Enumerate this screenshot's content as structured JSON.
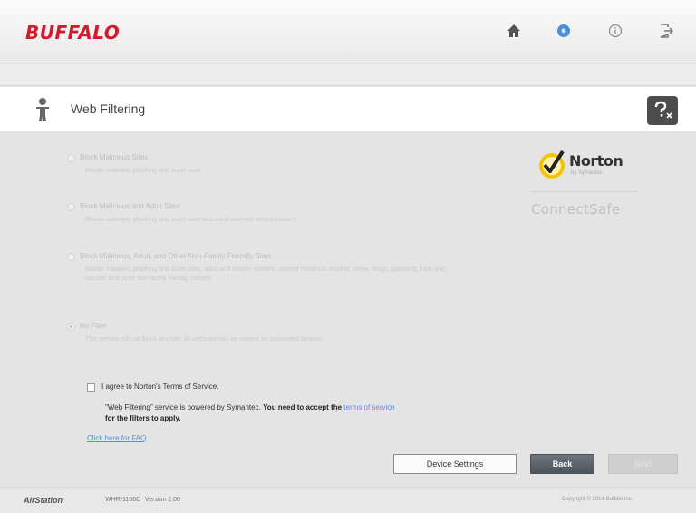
{
  "header": {
    "logo": "BUFFALO",
    "nav": [
      {
        "icon": "home-icon"
      },
      {
        "icon": "settings-gear-icon",
        "active_color": "#4a90d9"
      },
      {
        "icon": "info-icon"
      },
      {
        "icon": "logout-icon"
      }
    ]
  },
  "page": {
    "title": "Web Filtering",
    "title_icon": "person-icon",
    "help_icon": "help-icon"
  },
  "options": [
    {
      "label": "Block Malicious Sites",
      "description": "Blocks malware, phishing and scam sites",
      "selected": false
    },
    {
      "label": "Block Malicious and Adult Sites",
      "description": "Blocks malware, phishing and scam sites and adult-oriented sexual content",
      "selected": false
    },
    {
      "label": "Block Malicious, Adult, and Other Non-Family Friendly Sites",
      "description": "Blocks malware, phishing and scam sites, adult and mature content, content related to alcohol, crime, drugs, gambling, hate and suicide, and other non-family friendly content",
      "selected": false
    },
    {
      "label": "No Filter",
      "description": "This service will not block any site; all websites can be viewed on connected devices.",
      "selected": true
    }
  ],
  "norton": {
    "name": "Norton",
    "sub": "by Symantec",
    "product": "ConnectSafe"
  },
  "agreement": {
    "checkbox_label": "I agree to Norton's Terms of Service.",
    "text_prefix": "\"Web Filtering\" service is powered by Symantec.",
    "text_bold": "You need to accept the",
    "terms_link": "terms of service",
    "text_bold_2": "for the filters to apply.",
    "faq_link": "Click here for FAQ"
  },
  "buttons": {
    "device_settings": "Device Settings",
    "back": "Back",
    "next": "Next"
  },
  "footer": {
    "brand": "AirStation",
    "model": "WHR-1166D",
    "version": "Version 2.00",
    "copyright": "Copyright © 2014 Buffalo Inc."
  },
  "colors": {
    "brand_red": "#d7182a",
    "link_blue": "#5b8ed6",
    "norton_yellow": "#f5c400"
  }
}
